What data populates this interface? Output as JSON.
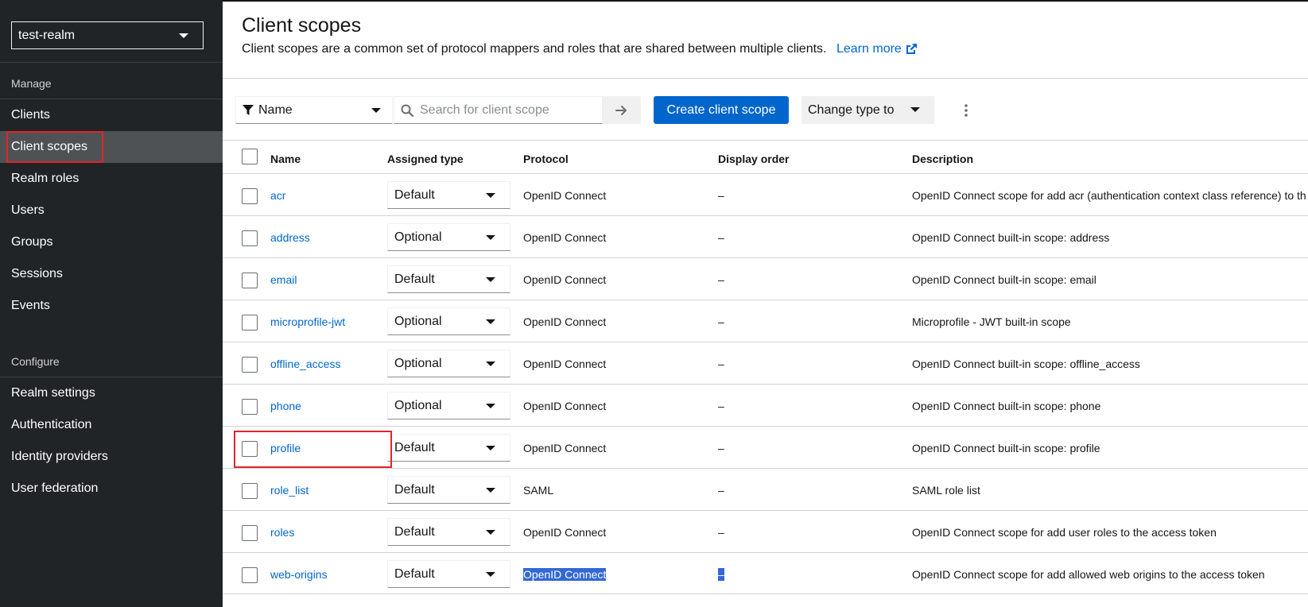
{
  "sidebar": {
    "realm": "test-realm",
    "manage_title": "Manage",
    "manage_items": [
      {
        "label": "Clients"
      },
      {
        "label": "Client scopes"
      },
      {
        "label": "Realm roles"
      },
      {
        "label": "Users"
      },
      {
        "label": "Groups"
      },
      {
        "label": "Sessions"
      },
      {
        "label": "Events"
      }
    ],
    "configure_title": "Configure",
    "configure_items": [
      {
        "label": "Realm settings"
      },
      {
        "label": "Authentication"
      },
      {
        "label": "Identity providers"
      },
      {
        "label": "User federation"
      }
    ],
    "active_item": "Client scopes"
  },
  "header": {
    "title": "Client scopes",
    "description": "Client scopes are a common set of protocol mappers and roles that are shared between multiple clients.",
    "learn_more": "Learn more"
  },
  "toolbar": {
    "filter_label": "Name",
    "search_placeholder": "Search for client scope",
    "create_label": "Create client scope",
    "change_type_label": "Change type to"
  },
  "table": {
    "columns": {
      "name": "Name",
      "assigned_type": "Assigned type",
      "protocol": "Protocol",
      "display_order": "Display order",
      "description": "Description"
    },
    "rows": [
      {
        "name": "acr",
        "type": "Default",
        "protocol": "OpenID Connect",
        "order": "–",
        "description": "OpenID Connect scope for add acr (authentication context class reference) to th"
      },
      {
        "name": "address",
        "type": "Optional",
        "protocol": "OpenID Connect",
        "order": "–",
        "description": "OpenID Connect built-in scope: address"
      },
      {
        "name": "email",
        "type": "Default",
        "protocol": "OpenID Connect",
        "order": "–",
        "description": "OpenID Connect built-in scope: email"
      },
      {
        "name": "microprofile-jwt",
        "type": "Optional",
        "protocol": "OpenID Connect",
        "order": "–",
        "description": "Microprofile - JWT built-in scope"
      },
      {
        "name": "offline_access",
        "type": "Optional",
        "protocol": "OpenID Connect",
        "order": "–",
        "description": "OpenID Connect built-in scope: offline_access"
      },
      {
        "name": "phone",
        "type": "Optional",
        "protocol": "OpenID Connect",
        "order": "–",
        "description": "OpenID Connect built-in scope: phone"
      },
      {
        "name": "profile",
        "type": "Default",
        "protocol": "OpenID Connect",
        "order": "–",
        "description": "OpenID Connect built-in scope: profile"
      },
      {
        "name": "role_list",
        "type": "Default",
        "protocol": "SAML",
        "order": "–",
        "description": "SAML role list"
      },
      {
        "name": "roles",
        "type": "Default",
        "protocol": "OpenID Connect",
        "order": "–",
        "description": "OpenID Connect scope for add user roles to the access token"
      },
      {
        "name": "web-origins",
        "type": "Default",
        "protocol": "OpenID Connect",
        "order": "–",
        "description": "OpenID Connect scope for add allowed web origins to the access token"
      }
    ]
  },
  "colors": {
    "sidebar_bg": "#212427",
    "sidebar_active": "#4f5255",
    "link": "#0066cc",
    "primary_button": "#0066cc",
    "highlight_border": "#e0252a",
    "selection": "#3367d6"
  }
}
